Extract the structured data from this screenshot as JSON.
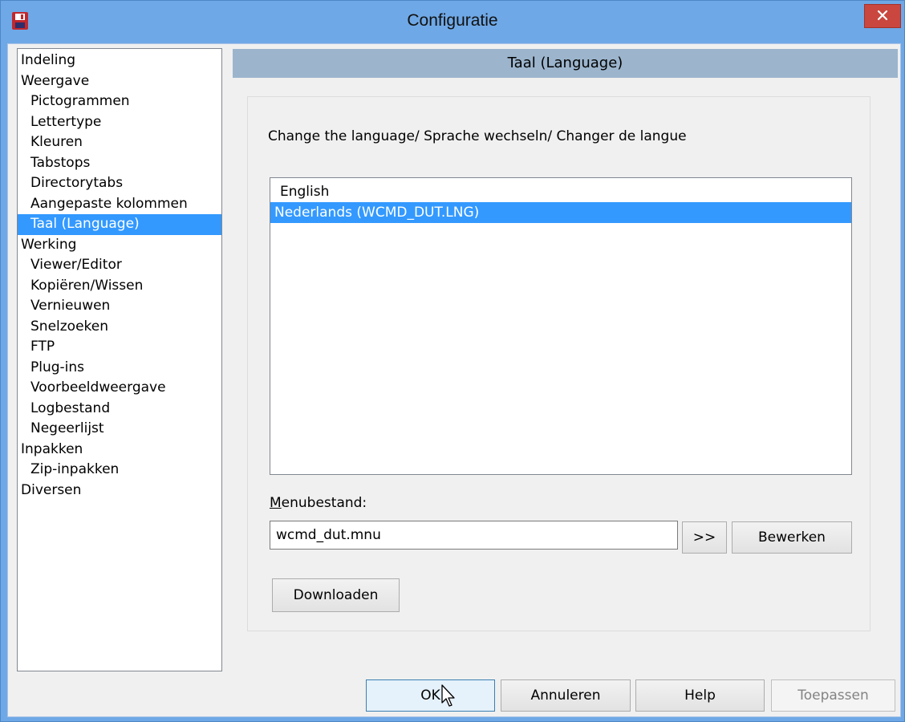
{
  "window": {
    "title": "Configuratie",
    "icons": {
      "app": "floppy-disk-icon",
      "close": "close-icon"
    }
  },
  "tree": {
    "items": [
      {
        "label": "Indeling",
        "level": 0,
        "selected": false
      },
      {
        "label": "Weergave",
        "level": 0,
        "selected": false
      },
      {
        "label": "Pictogrammen",
        "level": 1,
        "selected": false
      },
      {
        "label": "Lettertype",
        "level": 1,
        "selected": false
      },
      {
        "label": "Kleuren",
        "level": 1,
        "selected": false
      },
      {
        "label": "Tabstops",
        "level": 1,
        "selected": false
      },
      {
        "label": "Directorytabs",
        "level": 1,
        "selected": false
      },
      {
        "label": "Aangepaste kolommen",
        "level": 1,
        "selected": false
      },
      {
        "label": "Taal (Language)",
        "level": 1,
        "selected": true
      },
      {
        "label": "Werking",
        "level": 0,
        "selected": false
      },
      {
        "label": "Viewer/Editor",
        "level": 1,
        "selected": false
      },
      {
        "label": "Kopiëren/Wissen",
        "level": 1,
        "selected": false
      },
      {
        "label": "Vernieuwen",
        "level": 1,
        "selected": false
      },
      {
        "label": "Snelzoeken",
        "level": 1,
        "selected": false
      },
      {
        "label": "FTP",
        "level": 1,
        "selected": false
      },
      {
        "label": "Plug-ins",
        "level": 1,
        "selected": false
      },
      {
        "label": "Voorbeeldweergave",
        "level": 1,
        "selected": false
      },
      {
        "label": "Logbestand",
        "level": 1,
        "selected": false
      },
      {
        "label": "Negeerlijst",
        "level": 1,
        "selected": false
      },
      {
        "label": "Inpakken",
        "level": 0,
        "selected": false
      },
      {
        "label": "Zip-inpakken",
        "level": 1,
        "selected": false
      },
      {
        "label": "Diversen",
        "level": 0,
        "selected": false
      }
    ]
  },
  "panel": {
    "header": "Taal (Language)",
    "intro": "Change the language/ Sprache wechseln/ Changer de langue",
    "languages": [
      {
        "label": "English",
        "selected": false
      },
      {
        "label": "Nederlands (WCMD_DUT.LNG)",
        "selected": true
      }
    ],
    "menu_label_underlined": "M",
    "menu_label_rest": "enubestand:",
    "menu_value": "wcmd_dut.mnu",
    "browse_label": ">>",
    "edit_label": "Bewerken",
    "download_label": "Downloaden"
  },
  "footer": {
    "ok_label": "OK",
    "cancel_label": "Annuleren",
    "help_label": "Help",
    "apply_label": "Toepassen",
    "cursor_icon": "mouse-pointer-icon"
  },
  "colors": {
    "titlebar": "#6fa8e6",
    "close": "#c9473f",
    "selection": "#3399ff",
    "panel_header": "#9cb5cd"
  }
}
